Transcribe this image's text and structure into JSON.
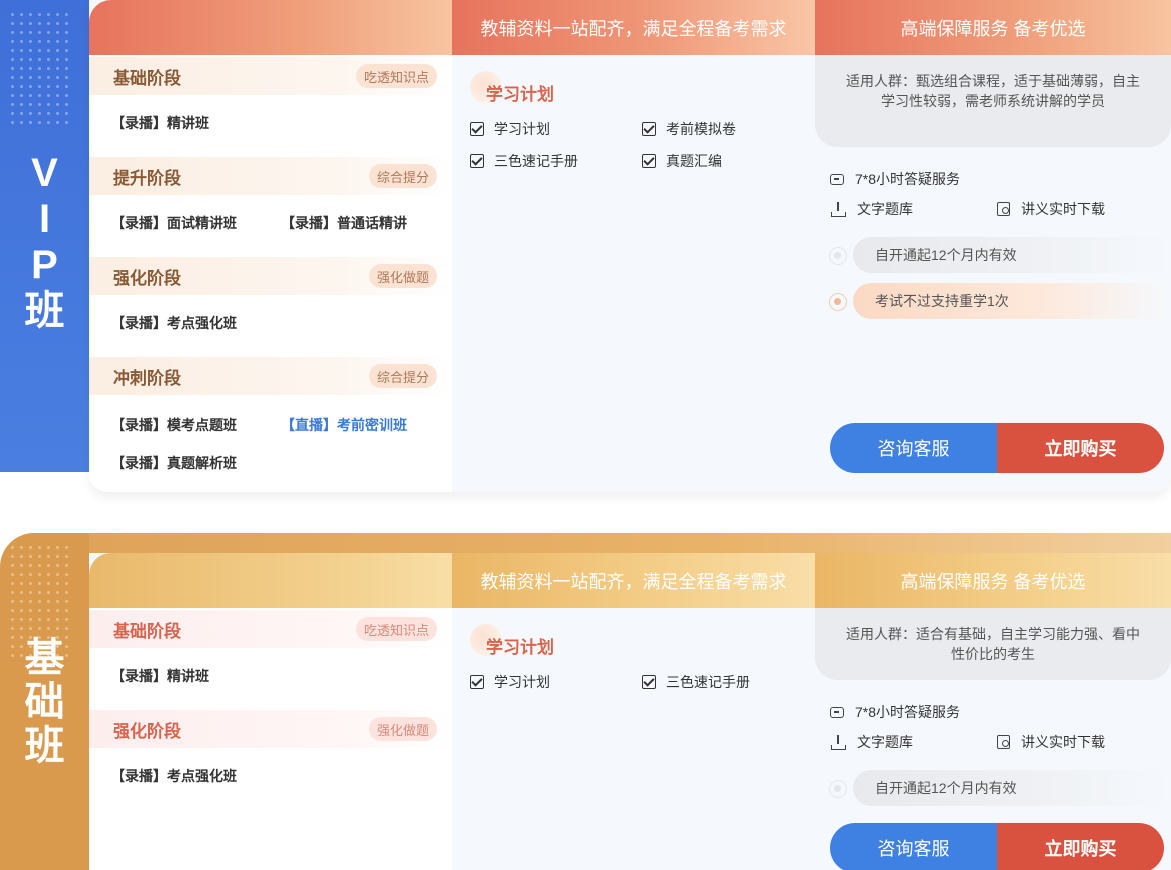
{
  "vip": {
    "side_label": [
      "V",
      "I",
      "P",
      "班"
    ],
    "headers": [
      "",
      "教辅资料一站配齐，满足全程备考需求",
      "高端保障服务 备考优选"
    ],
    "stages": [
      {
        "title": "基础阶段",
        "tag": "吃透知识点",
        "courses": [
          {
            "text": "【录播】精讲班",
            "live": false
          }
        ]
      },
      {
        "title": "提升阶段",
        "tag": "综合提分",
        "courses": [
          {
            "text": "【录播】面试精讲班",
            "live": false
          },
          {
            "text": "【录播】普通话精讲",
            "live": false
          }
        ]
      },
      {
        "title": "强化阶段",
        "tag": "强化做题",
        "courses": [
          {
            "text": "【录播】考点强化班",
            "live": false
          }
        ]
      },
      {
        "title": "冲刺阶段",
        "tag": "综合提分",
        "courses": [
          {
            "text": "【录播】模考点题班",
            "live": false
          },
          {
            "text": "【直播】考前密训班",
            "live": true
          },
          {
            "text": "【录播】真题解析班",
            "live": false
          }
        ]
      }
    ],
    "plan_title": "学习计划",
    "materials": [
      "学习计划",
      "考前模拟卷",
      "三色速记手册",
      "真题汇编"
    ],
    "audience": "适用人群：甄选组合课程，适于基础薄弱，自主学习性较弱，需老师系统讲解的学员",
    "services": {
      "qa": "7*8小时答疑服务",
      "question_bank": "文字题库",
      "handout": "讲义实时下载"
    },
    "validity": [
      "自开通起12个月内有效",
      "考试不过支持重学1次"
    ],
    "consult_label": "咨询客服",
    "buy_label": "立即购买"
  },
  "basic": {
    "side_label": [
      "基",
      "础",
      "班"
    ],
    "headers": [
      "",
      "教辅资料一站配齐，满足全程备考需求",
      "高端保障服务 备考优选"
    ],
    "stages": [
      {
        "title": "基础阶段",
        "tag": "吃透知识点",
        "courses": [
          {
            "text": "【录播】精讲班",
            "live": false
          }
        ]
      },
      {
        "title": "强化阶段",
        "tag": "强化做题",
        "courses": [
          {
            "text": "【录播】考点强化班",
            "live": false
          }
        ]
      }
    ],
    "plan_title": "学习计划",
    "materials": [
      "学习计划",
      "三色速记手册"
    ],
    "audience": "适用人群：适合有基础，自主学习能力强、看中性价比的考生",
    "services": {
      "qa": "7*8小时答疑服务",
      "question_bank": "文字题库",
      "handout": "讲义实时下载"
    },
    "validity": [
      "自开通起12个月内有效"
    ],
    "consult_label": "咨询客服",
    "buy_label": "立即购买"
  }
}
